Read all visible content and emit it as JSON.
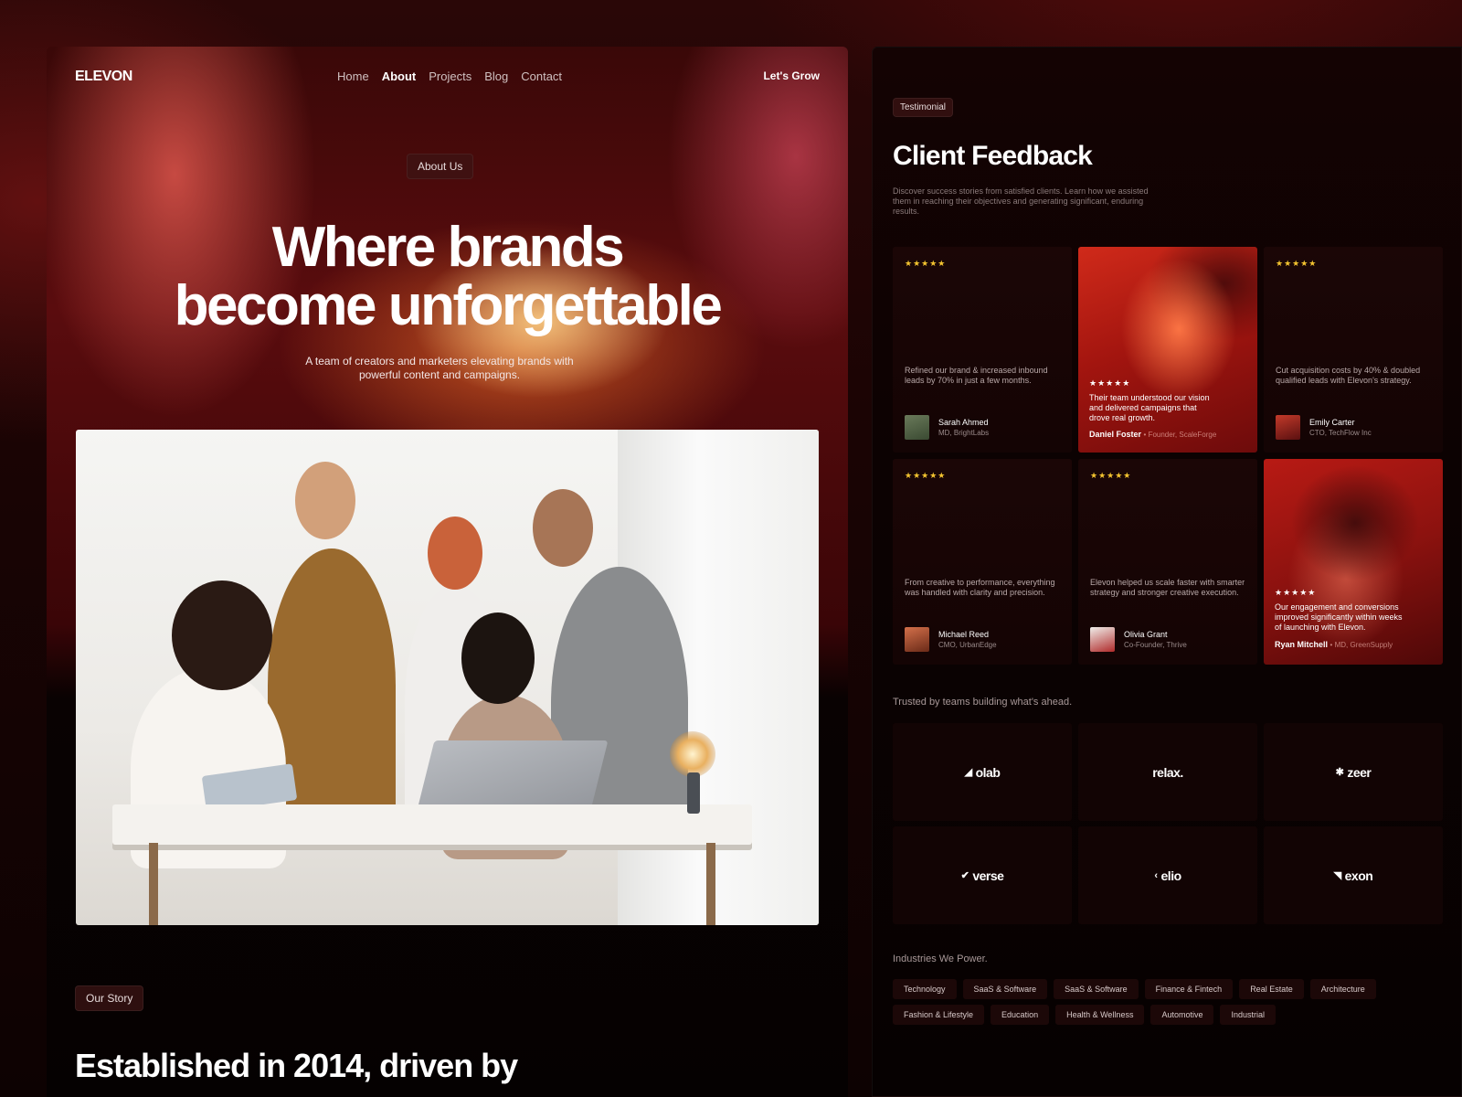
{
  "nav": {
    "logo": "ELEVON",
    "links": [
      "Home",
      "About",
      "Projects",
      "Blog",
      "Contact"
    ],
    "active": "About",
    "cta": "Let's Grow"
  },
  "hero": {
    "badge": "About Us",
    "title_line1": "Where brands",
    "title_line2": "become unforgettable",
    "subtitle": "A team of creators and marketers elevating brands with powerful content and campaigns."
  },
  "story": {
    "badge": "Our Story",
    "title": "Established in 2014, driven by"
  },
  "testimonials": {
    "badge": "Testimonial",
    "title": "Client Feedback",
    "description": "Discover success stories from satisfied clients. Learn how we assisted them in reaching their objectives and generating significant, enduring results.",
    "stars": "★★★★★",
    "cards": [
      {
        "quote": "Refined our brand & increased inbound leads by 70% in just a few months.",
        "name": "Sarah Ahmed",
        "role": "MD, BrightLabs"
      },
      {
        "quote": "Their team understood our vision and delivered campaigns that drove real growth.",
        "name": "Daniel Foster",
        "role": "Founder, ScaleForge"
      },
      {
        "quote": "Cut acquisition costs by 40% & doubled qualified leads with Elevon's strategy.",
        "name": "Emily Carter",
        "role": "CTO, TechFlow Inc"
      },
      {
        "quote": "From creative to performance, everything was handled with clarity and precision.",
        "name": "Michael Reed",
        "role": "CMO, UrbanEdge"
      },
      {
        "quote": "Elevon helped us scale faster with smarter strategy and stronger creative execution.",
        "name": "Olivia Grant",
        "role": "Co-Founder, Thrive"
      },
      {
        "quote": "Our engagement and conversions improved significantly within weeks of launching with Elevon.",
        "name": "Ryan Mitchell",
        "role": "MD, GreenSupply"
      }
    ]
  },
  "trusted": {
    "title": "Trusted by teams building what's ahead.",
    "logos": [
      {
        "name": "olab",
        "mark": "◢"
      },
      {
        "name": "relax.",
        "mark": ""
      },
      {
        "name": "zeer",
        "mark": "✱"
      },
      {
        "name": "verse",
        "mark": "✔"
      },
      {
        "name": "elio",
        "mark": "‹"
      },
      {
        "name": "exon",
        "mark": "◥"
      }
    ]
  },
  "industries": {
    "title": "Industries We Power.",
    "tags": [
      "Technology",
      "SaaS & Software",
      "SaaS & Software",
      "Finance & Fintech",
      "Real Estate",
      "Architecture",
      "Fashion & Lifestyle",
      "Education",
      "Health & Wellness",
      "Automotive",
      "Industrial"
    ]
  },
  "colors": {
    "accent_star": "#f4c430",
    "brand_red": "#b81a14",
    "panel_bg": "#0c0202"
  }
}
